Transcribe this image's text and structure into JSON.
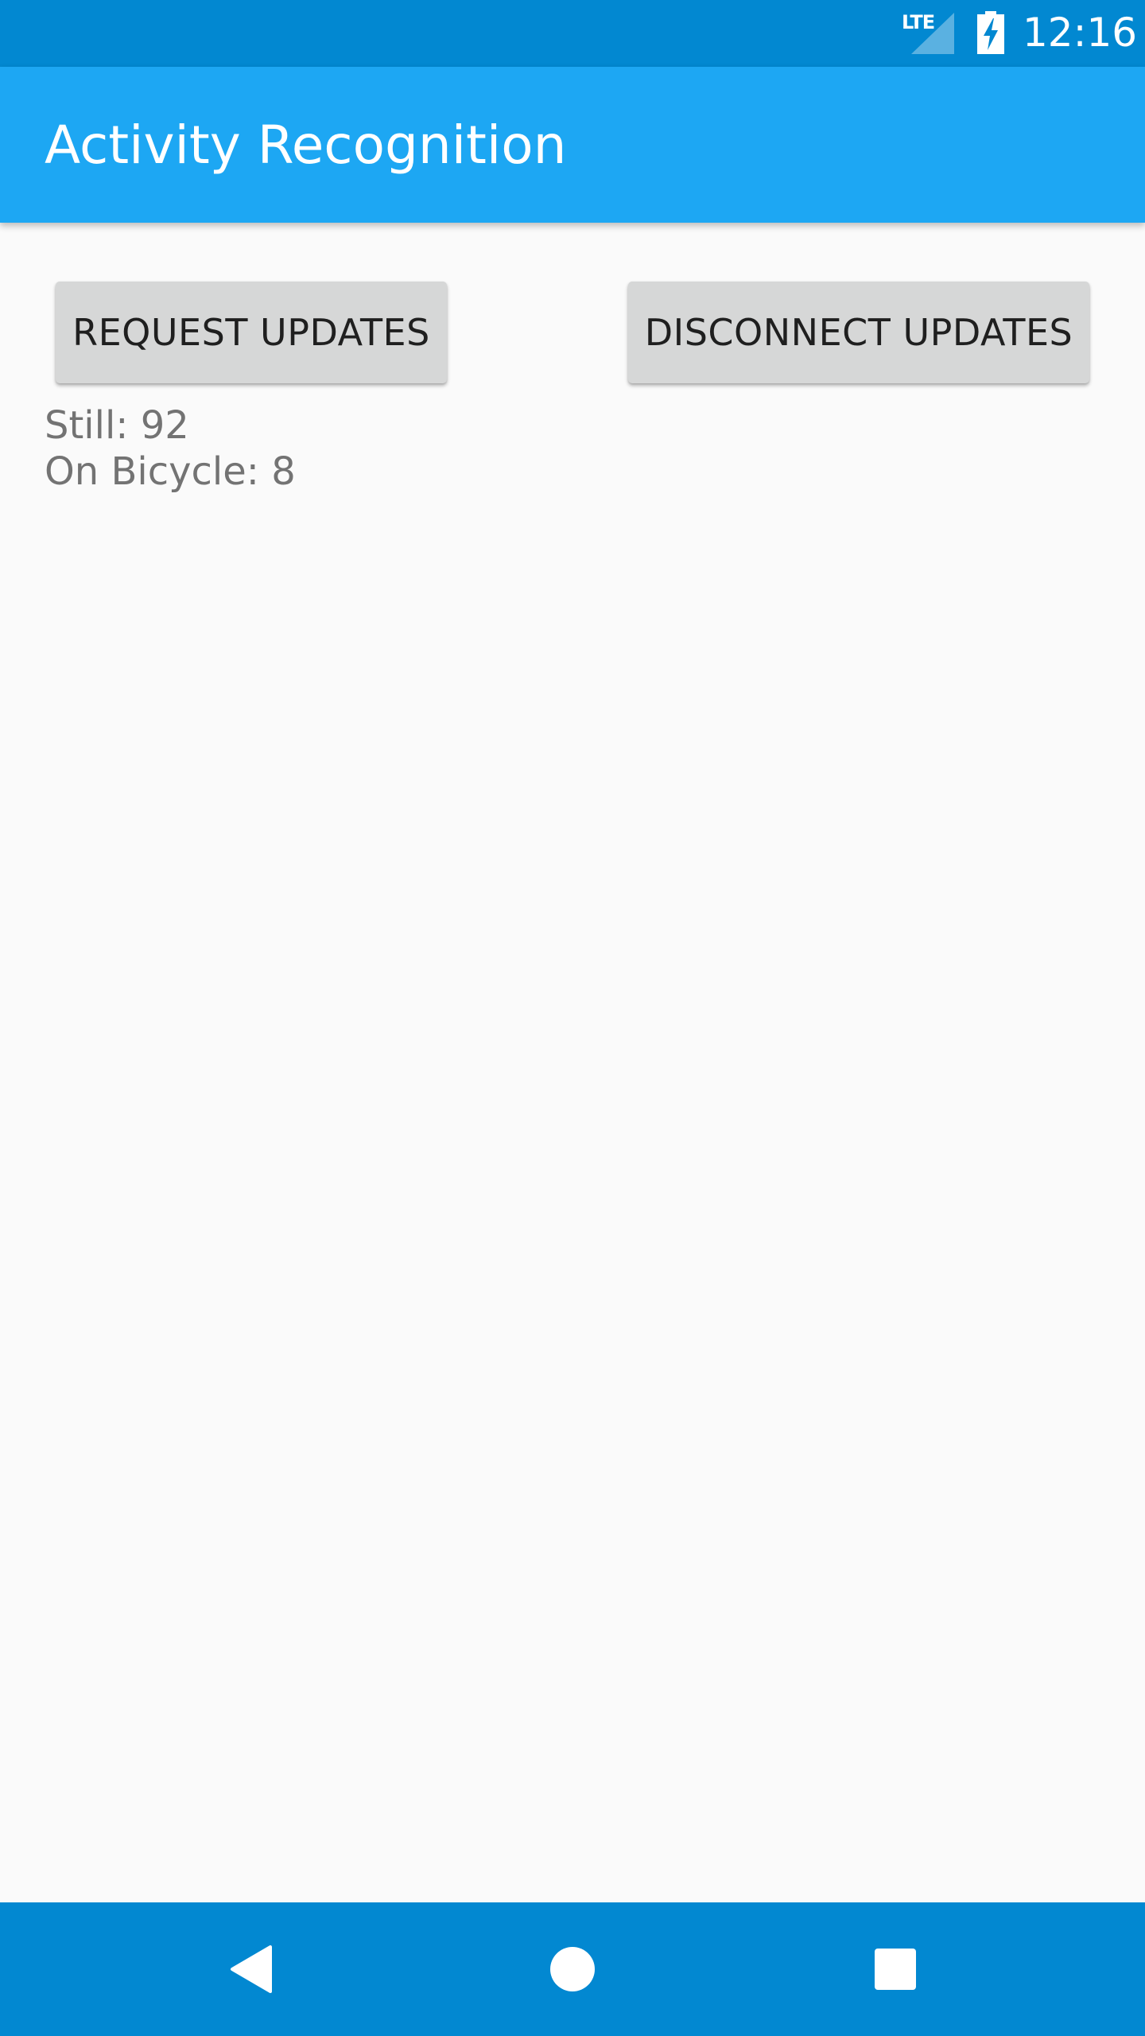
{
  "status_bar": {
    "network_label": "LTE",
    "signal_icon": "signal-icon",
    "battery_icon": "battery-charging-icon",
    "time": "12:16",
    "background_color": "#0288d1"
  },
  "app_bar": {
    "title": "Activity Recognition",
    "background_color": "#1da7f3"
  },
  "buttons": {
    "request_label": "REQUEST UPDATES",
    "disconnect_label": "DISCONNECT UPDATES"
  },
  "activities": [
    {
      "text": "Still: 92"
    },
    {
      "text": "On Bicycle: 8"
    }
  ],
  "nav_bar": {
    "back_icon": "back-icon",
    "home_icon": "home-icon",
    "recents_icon": "recents-icon",
    "background_color": "#0288d1"
  }
}
